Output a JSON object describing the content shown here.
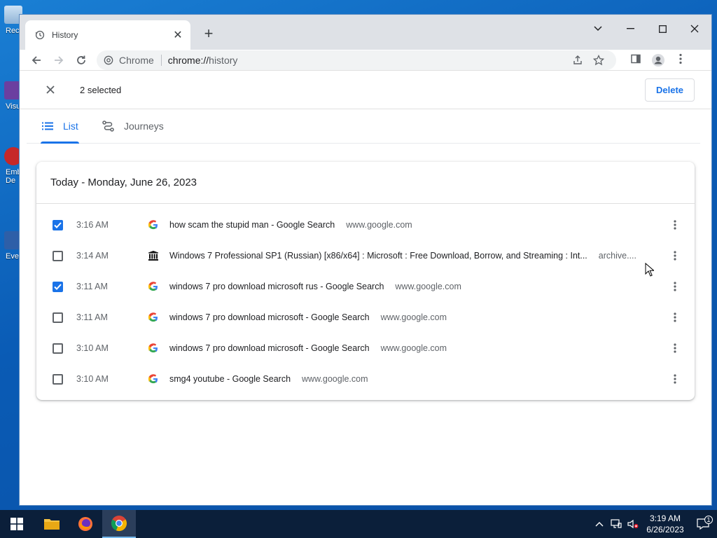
{
  "desktop": {
    "icons": [
      {
        "label": "Rec"
      },
      {
        "label": "Visu"
      },
      {
        "label": "Emb"
      },
      {
        "label": "De"
      },
      {
        "label": "Eve"
      }
    ]
  },
  "browser": {
    "tab": {
      "title": "History"
    },
    "omnibox": {
      "site_label": "Chrome",
      "url_host": "chrome://",
      "url_path": "history"
    }
  },
  "history": {
    "selection_count": "2 selected",
    "delete_label": "Delete",
    "tabs": [
      {
        "label": "List",
        "active": true
      },
      {
        "label": "Journeys",
        "active": false
      }
    ],
    "date_heading": "Today - Monday, June 26, 2023",
    "entries": [
      {
        "checked": true,
        "time": "3:16 AM",
        "favicon": "google-g-icon",
        "title": "how scam the stupid man - Google Search",
        "domain": "www.google.com"
      },
      {
        "checked": false,
        "time": "3:14 AM",
        "favicon": "archive-org-icon",
        "title": "Windows 7 Professional SP1 (Russian) [x86/x64] : Microsoft : Free Download, Borrow, and Streaming : Int...",
        "domain": "archive...."
      },
      {
        "checked": true,
        "time": "3:11 AM",
        "favicon": "google-g-icon",
        "title": "windows 7 pro download microsoft rus - Google Search",
        "domain": "www.google.com"
      },
      {
        "checked": false,
        "time": "3:11 AM",
        "favicon": "google-g-icon",
        "title": "windows 7 pro download microsoft - Google Search",
        "domain": "www.google.com"
      },
      {
        "checked": false,
        "time": "3:10 AM",
        "favicon": "google-g-icon",
        "title": "windows 7 pro download microsoft - Google Search",
        "domain": "www.google.com"
      },
      {
        "checked": false,
        "time": "3:10 AM",
        "favicon": "google-g-icon",
        "title": "smg4 youtube - Google Search",
        "domain": "www.google.com"
      }
    ]
  },
  "taskbar": {
    "clock_time": "3:19 AM",
    "clock_date": "6/26/2023",
    "notification_count": "1"
  },
  "colors": {
    "accent": "#1a73e8",
    "taskbar": "#0b1f3a",
    "desktop": "#0a5bb5"
  }
}
